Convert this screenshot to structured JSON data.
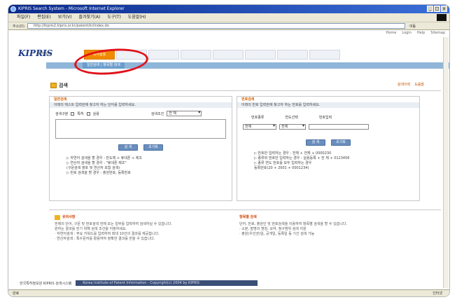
{
  "window": {
    "title": "KIPRIS Search System - Microsoft Internet Explorer",
    "buttons": [
      "_",
      "□",
      "x"
    ]
  },
  "menu": [
    "파일(F)",
    "편집(E)",
    "보기(V)",
    "즐겨찾기(A)",
    "도구(T)",
    "도움말(H)"
  ],
  "address": {
    "label": "주소(D)",
    "url": "http://kipris2.kipris.or.kr/patent/kr/index.do",
    "go": "이동"
  },
  "util_links": [
    "Home",
    "Login",
    "Help",
    "Sitemap"
  ],
  "brand": {
    "logo": "KIPRIS",
    "sub": "특허정보"
  },
  "nav": {
    "tabs": [
      "특허실용",
      "",
      "",
      "",
      "",
      "",
      "",
      ""
    ],
    "active_index": 0,
    "sub_active": "일반검색 | 항목별 검색"
  },
  "page": {
    "title": "검색",
    "links": [
      "검색이력",
      "도움말"
    ]
  },
  "left_panel": {
    "heading": "일반검색",
    "desc": "아래의 텍스트 입력란에 찾고자 하는 단어를 입력하세요.",
    "scope_label": "검색구분",
    "check1": "특허",
    "check2": "실용",
    "sort_label": "검색조건",
    "sort_value": "전 체",
    "btn_search": "검 색",
    "btn_reset": "초기화",
    "notes": [
      "▷ 자연어 검색을 할 경우 : 반도체 + 휴대폰 + 제조",
      "▷ 연산자 검색을 할 경우 : \"휴대폰 제조\"",
      "  (구문검색 괄호 및 연산자 포함 검색)",
      "▷ 번호 검색을 할 경우 : 출원번호, 등록번호"
    ]
  },
  "right_panel": {
    "heading": "번호검색",
    "desc": "아래의 번호 입력란에 찾고자 하는 번호를 입력하세요.",
    "col1": "번호종류",
    "col2": "연도선택",
    "col3": "번호입력",
    "sel1": "전체",
    "sel2": "전체",
    "btn_search": "검 색",
    "btn_reset": "초기화",
    "notes": [
      "▷ 번호만 입력하는 경우 : 전체 + 전체 + 0000230",
      "▷ 종류와 번호만 입력하는 경우 : 실용등록 + 전 체 + 0123456",
      "▷ 종류 연도 번호를 모두 입력하는 경우",
      "  등록번호(20 + 2001 + 0001234)"
    ]
  },
  "lower_left": {
    "heading": "유의사항",
    "lines": [
      "전체의 단어, 구문 및 번호검색 전체 또는 일부를 입력하여 검색하실 수 있습니다.",
      "원하는 결과를 얻기 위해 검색 조건을 지정하세요.",
      "· 자연어검색 : 주요 키워드를 입력하여 최대 10건의 결과를 제공합니다.",
      "· 연산자검색 : 특수문자를 활용하여 정확한 결과를 얻을 수 있습니다."
    ]
  },
  "lower_right": {
    "heading": "항목별 검색",
    "lines": [
      "단어, 번호, 출원인 및 번호검색을 이용하여 항목별 검색을 할 수 있습니다.",
      "· 소분, 발명의 명칭, 요약, 청구범위 검색 지원",
      "· 출원(우선권)일, 공개일, 등록일 등 기간 검색 가능"
    ]
  },
  "footer": {
    "left": "한국특허정보원 KIPRIS 검색시스템",
    "copyright": "Korea Institute of Patent Information - Copyright(c) 2004 by KIPRIS"
  },
  "status": {
    "left": "완료",
    "zone": "인터넷"
  }
}
